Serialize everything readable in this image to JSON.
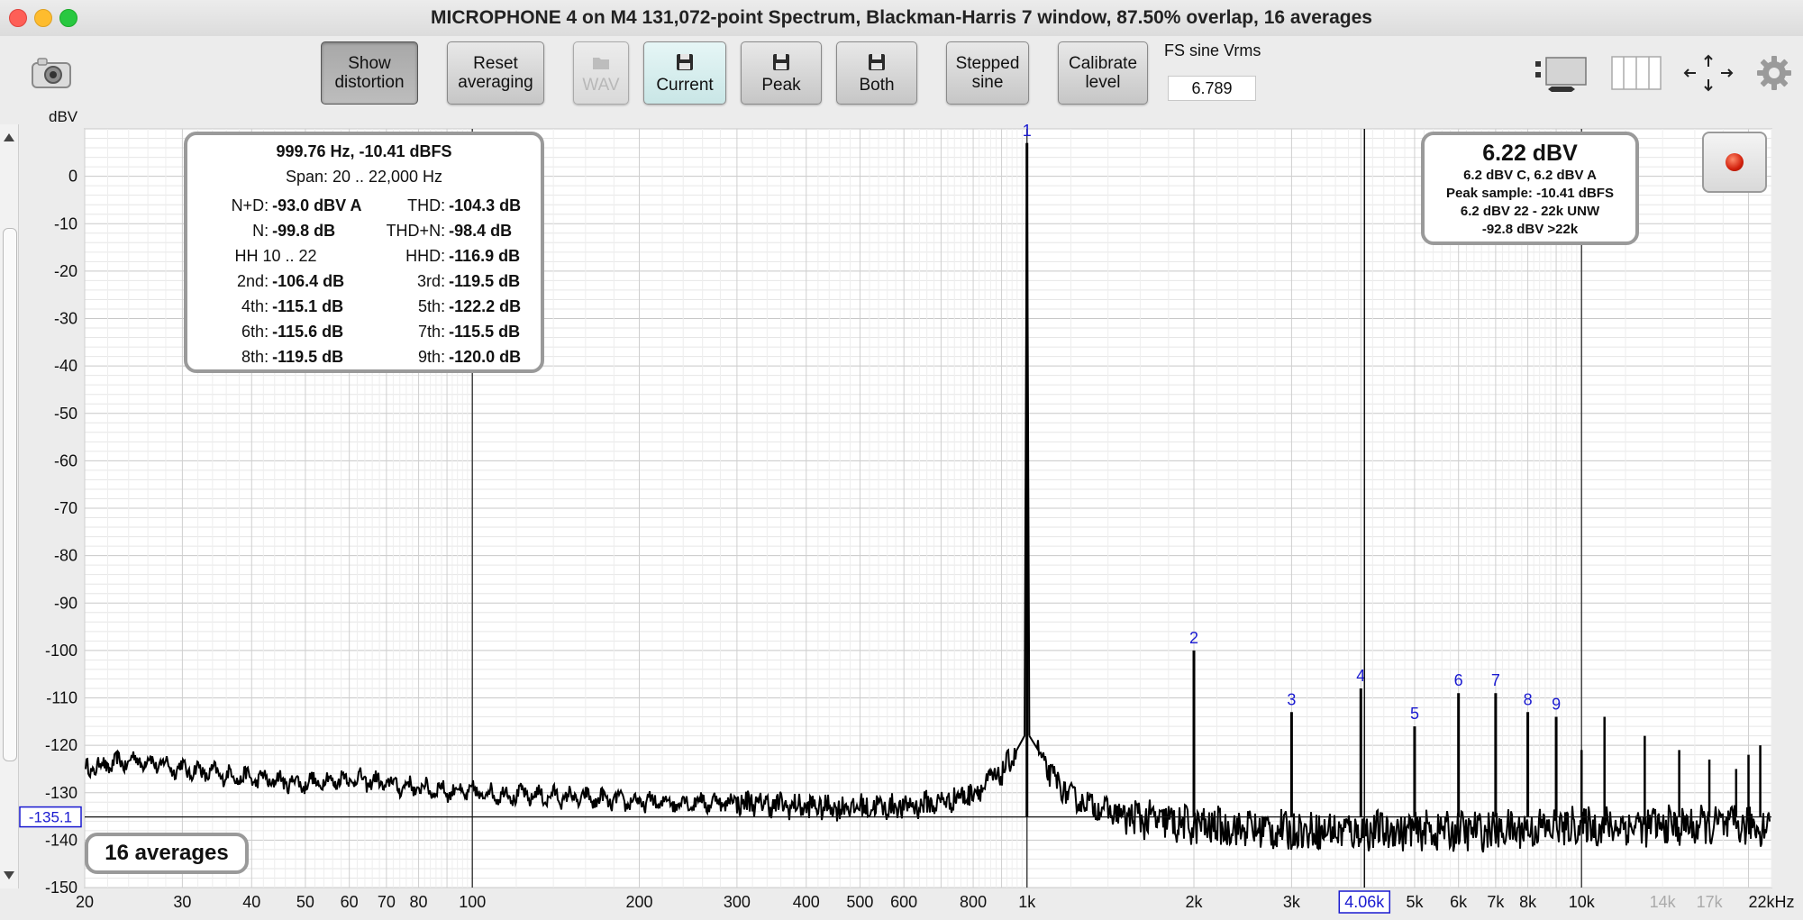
{
  "window": {
    "title": "MICROPHONE 4 on M4 131,072-point Spectrum, Blackman-Harris 7 window, 87.50% overlap, 16 averages"
  },
  "toolbar": {
    "buttons": [
      {
        "label": "Show\ndistortion"
      },
      {
        "label": "Reset\naveraging"
      },
      {
        "label": "WAV"
      },
      {
        "label": "Current"
      },
      {
        "label": "Peak"
      },
      {
        "label": "Both"
      },
      {
        "label": "Stepped\nsine"
      },
      {
        "label": "Calibrate\nlevel"
      }
    ],
    "fs_label": "FS sine Vrms",
    "fs_value": "6.789"
  },
  "icons": {
    "camera": "camera-icon",
    "layout": "layout-toggle-icon",
    "columns": "columns-icon",
    "expand": "expand-arrows-icon",
    "settings": "gear-icon",
    "record": "record-icon"
  },
  "axis": {
    "y_unit": "dBV",
    "y_ticks": [
      "0",
      "-10",
      "-20",
      "-30",
      "-40",
      "-50",
      "-60",
      "-70",
      "-80",
      "-90",
      "-100",
      "-110",
      "-120",
      "-130",
      "-140",
      "-150"
    ],
    "x_ticks": [
      "20",
      "30",
      "40",
      "50",
      "60",
      "70",
      "80",
      "100",
      "200",
      "300",
      "400",
      "500",
      "600",
      "800",
      "1k",
      "2k",
      "3k",
      "4k",
      "5k",
      "6k",
      "7k",
      "8k",
      "10k",
      "14k",
      "17k",
      "22kHz"
    ],
    "x_ticks_faded": [
      "14k",
      "17k"
    ],
    "y_marker": "-135.1",
    "x_marker": "4.06k"
  },
  "harmonic_labels": [
    "1",
    "2",
    "3",
    "4",
    "5",
    "6",
    "7",
    "8",
    "9"
  ],
  "distortion": {
    "header1": "999.76 Hz, -10.41 dBFS",
    "header2": "Span: 20 .. 22,000 Hz",
    "rows": [
      [
        "N+D:",
        "-93.0 dBV A",
        "THD:",
        "-104.3 dB"
      ],
      [
        "N:",
        "-99.8 dB",
        "THD+N:",
        "-98.4 dB"
      ],
      [
        "HH 10 .. 22",
        "",
        "HHD:",
        "-116.9 dB"
      ],
      [
        "2nd:",
        "-106.4 dB",
        "3rd:",
        "-119.5 dB"
      ],
      [
        "4th:",
        "-115.1 dB",
        "5th:",
        "-122.2 dB"
      ],
      [
        "6th:",
        "-115.6 dB",
        "7th:",
        "-115.5 dB"
      ],
      [
        "8th:",
        "-119.5 dB",
        "9th:",
        "-120.0 dB"
      ]
    ]
  },
  "level": {
    "main": "6.22 dBV",
    "lines": [
      "6.2 dBV C, 6.2 dBV A",
      "Peak sample: -10.41 dBFS",
      "6.2 dBV 22 - 22k UNW",
      "-92.8 dBV >22k"
    ]
  },
  "averages": "16 averages",
  "colors": {
    "trace": "#000000",
    "harmonic_label": "#1a1ad0",
    "panel_border": "#9a9a9a",
    "record": "#d2200c"
  },
  "chart_data": {
    "type": "line",
    "xlabel": "",
    "ylabel": "dBV",
    "xscale": "log",
    "xlim": [
      20,
      22000
    ],
    "ylim": [
      -150,
      10
    ],
    "grid": true,
    "series": [
      {
        "x": [
          20,
          25,
          30,
          40,
          50,
          60,
          80,
          100,
          150,
          200,
          300,
          400,
          500,
          600,
          700,
          800,
          900,
          950,
          980,
          1000,
          1020,
          1050,
          1100,
          1200,
          1500,
          2000,
          3000,
          4000,
          5000,
          7000,
          10000,
          15000,
          22000
        ],
        "y": [
          -125,
          -123,
          -125,
          -127,
          -128,
          -127,
          -129,
          -130,
          -131,
          -132,
          -132,
          -133,
          -133,
          -133,
          -132,
          -130,
          -126,
          -122,
          -116,
          7,
          -116,
          -122,
          -126,
          -131,
          -135,
          -137,
          -138,
          -138,
          -138,
          -138,
          -137,
          -137,
          -137
        ]
      }
    ],
    "peaks": [
      {
        "label": "1",
        "freq_hz": 1000,
        "db": 7
      },
      {
        "label": "2",
        "freq_hz": 2000,
        "db": -100
      },
      {
        "label": "3",
        "freq_hz": 3000,
        "db": -113
      },
      {
        "label": "4",
        "freq_hz": 4000,
        "db": -108
      },
      {
        "label": "5",
        "freq_hz": 5000,
        "db": -116
      },
      {
        "label": "6",
        "freq_hz": 6000,
        "db": -109
      },
      {
        "label": "7",
        "freq_hz": 7000,
        "db": -109
      },
      {
        "label": "8",
        "freq_hz": 8000,
        "db": -113
      },
      {
        "label": "9",
        "freq_hz": 9000,
        "db": -114
      }
    ],
    "extra_harmonics": [
      {
        "freq_hz": 10000,
        "db": -121
      },
      {
        "freq_hz": 11000,
        "db": -114
      },
      {
        "freq_hz": 13000,
        "db": -118
      },
      {
        "freq_hz": 15000,
        "db": -121
      },
      {
        "freq_hz": 17000,
        "db": -123
      },
      {
        "freq_hz": 19000,
        "db": -125
      },
      {
        "freq_hz": 20000,
        "db": -122
      },
      {
        "freq_hz": 21000,
        "db": -120
      }
    ]
  }
}
